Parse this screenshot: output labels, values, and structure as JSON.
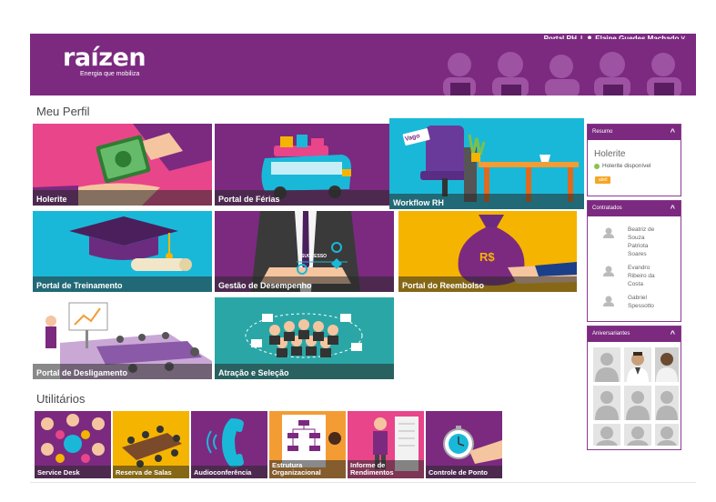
{
  "header": {
    "logo_text": "raízen",
    "tagline": "Energia que mobiliza",
    "portal_link": "Portal RH",
    "separator": "|",
    "user_name": "Elaine Guedes Machado",
    "user_chevron": "˅",
    "colors": {
      "brand": "#7b2a80"
    }
  },
  "profile": {
    "title": "Meu Perfil",
    "tiles": [
      {
        "id": "holerite",
        "label": "Holerite",
        "color": "#e8458b"
      },
      {
        "id": "ferias",
        "label": "Portal de Férias",
        "color": "#7b2a80"
      },
      {
        "id": "workflow",
        "label": "Workflow RH",
        "color": "#1ab8d8",
        "tag": "Vago"
      },
      {
        "id": "treinamento",
        "label": "Portal de Treinamento",
        "color": "#1ab8d8"
      },
      {
        "id": "desempenho",
        "label": "Gestão de Desempenho",
        "color": "#7b2a80",
        "caption": "SUCCESSO"
      },
      {
        "id": "reembolso",
        "label": "Portal do Reembolso",
        "color": "#f5b400",
        "money": "R$"
      },
      {
        "id": "desligamento",
        "label": "Portal de Desligamento",
        "color": "#f2f2f2"
      },
      {
        "id": "atracao",
        "label": "Atração e Seleção",
        "color": "#2aa6a6"
      }
    ]
  },
  "utilities": {
    "title": "Utilitários",
    "tiles": [
      {
        "id": "service-desk",
        "label": "Service Desk",
        "color": "#7b2a80"
      },
      {
        "id": "reserva-salas",
        "label": "Reserva de Salas",
        "color": "#f5b400"
      },
      {
        "id": "audioconferencia",
        "label": "Audioconferência",
        "color": "#7b2a80"
      },
      {
        "id": "estrutura",
        "label_line1": "Estrutura",
        "label_line2": "Organizacional",
        "color": "#f39c34"
      },
      {
        "id": "informe",
        "label_line1": "Informe de",
        "label_line2": "Rendimentos",
        "color": "#e8458b"
      },
      {
        "id": "ponto",
        "label": "Controle de Ponto",
        "color": "#7b2a80"
      }
    ]
  },
  "sidebar": {
    "resumo": {
      "title": "Resumo",
      "chevron": "^",
      "holerite_title": "Holerite",
      "status": "Holerite disponível",
      "badge": "abril"
    },
    "contratados": {
      "title": "Contratados",
      "chevron": "^",
      "people": [
        {
          "name": "Beatriz de Souza Patriota Soares",
          "lines": [
            "Beatriz de",
            "Souza",
            "Patriota",
            "Soares"
          ]
        },
        {
          "name": "Evandro Ribeiro da Costa",
          "lines": [
            "Evandro",
            "Ribeiro da",
            "Costa"
          ]
        },
        {
          "name": "Gabriel Spessotto",
          "lines": [
            "Gabriel",
            "Spessotto"
          ]
        }
      ]
    },
    "aniversariantes": {
      "title": "Aniversariantes",
      "chevron": "^"
    }
  }
}
